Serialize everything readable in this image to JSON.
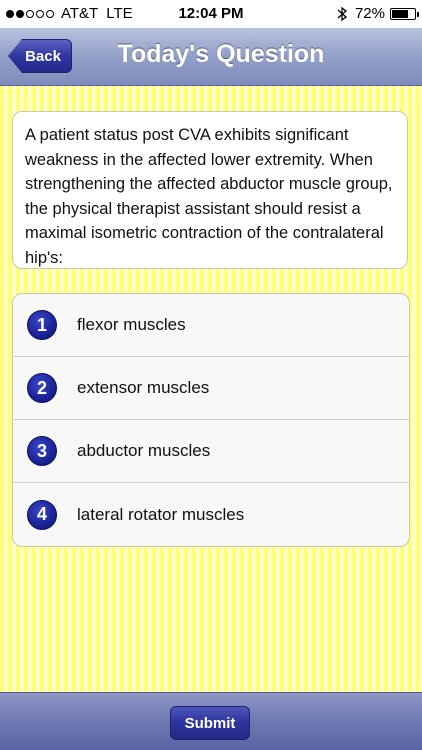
{
  "status_bar": {
    "carrier": "AT&T",
    "network": "LTE",
    "time": "12:04 PM",
    "battery": "72%",
    "battery_level": 0.72,
    "signal_bars_filled": 2,
    "signal_bars_total": 5
  },
  "nav": {
    "back_label": "Back",
    "title": "Today's Question"
  },
  "question": {
    "text": "A patient status post CVA exhibits significant weakness in the affected lower extremity. When strengthening the affected abductor muscle group, the physical therapist assistant should resist a maximal isometric contraction of the contralateral hip's:"
  },
  "options": [
    {
      "number": "1",
      "label": "flexor muscles"
    },
    {
      "number": "2",
      "label": "extensor muscles"
    },
    {
      "number": "3",
      "label": "abductor muscles"
    },
    {
      "number": "4",
      "label": "lateral rotator muscles"
    }
  ],
  "footer": {
    "submit_label": "Submit"
  },
  "icons": {
    "bluetooth": "bluetooth-icon",
    "battery": "battery-icon",
    "signal": "signal-icon"
  },
  "colors": {
    "accent": "#222a8c",
    "background": "#ffff88"
  }
}
